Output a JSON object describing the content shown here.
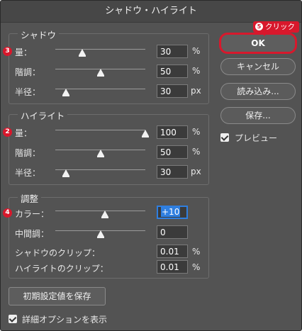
{
  "dialog": {
    "title": "シャドウ・ハイライト"
  },
  "shadows": {
    "title": "シャドウ",
    "badge": "3",
    "rows": [
      {
        "label": "量：",
        "value": "30",
        "unit": "%",
        "level": 0.3
      },
      {
        "label": "階調：",
        "value": "50",
        "unit": "%",
        "level": 0.5
      },
      {
        "label": "半径：",
        "value": "30",
        "unit": "px",
        "level": 0.12
      }
    ]
  },
  "highlights": {
    "title": "ハイライト",
    "badge": "2",
    "rows": [
      {
        "label": "量：",
        "value": "100",
        "unit": "%",
        "level": 1.0
      },
      {
        "label": "階調：",
        "value": "50",
        "unit": "%",
        "level": 0.5
      },
      {
        "label": "半径：",
        "value": "30",
        "unit": "px",
        "level": 0.12
      }
    ]
  },
  "adjustments": {
    "title": "調整",
    "badge": "4",
    "color": {
      "label": "カラー：",
      "value": "+10",
      "level": 0.55
    },
    "midtone": {
      "label": "中間調：",
      "value": "0",
      "level": 0.5
    },
    "shadow_clip": {
      "label": "シャドウのクリップ：",
      "value": "0.01",
      "unit": "%"
    },
    "highlight_clip": {
      "label": "ハイライトのクリップ：",
      "value": "0.01",
      "unit": "%"
    }
  },
  "buttons": {
    "ok": "OK",
    "cancel": "キャンセル",
    "load": "読み込み...",
    "save": "保存...",
    "save_defaults": "初期設定値を保存"
  },
  "preview": {
    "label": "プレビュー",
    "checked": true
  },
  "more_options": {
    "label": "詳細オプションを表示",
    "checked": true
  },
  "callout": {
    "number": "5",
    "text": "クリック"
  },
  "colors": {
    "accent": "#d8182c",
    "selection": "#2f7fe0",
    "panel": "#535353"
  }
}
